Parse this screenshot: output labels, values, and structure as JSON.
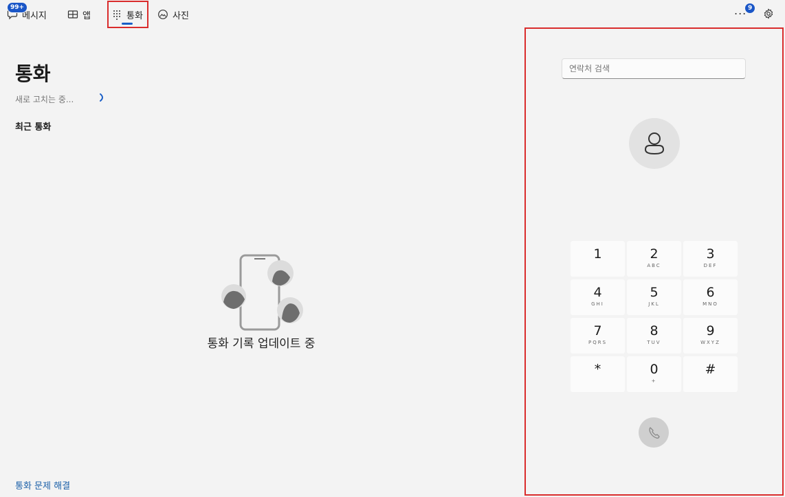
{
  "nav": {
    "tabs": [
      {
        "label": "메시지",
        "icon": "message-icon",
        "badge": "99+"
      },
      {
        "label": "앱",
        "icon": "apps-icon"
      },
      {
        "label": "통화",
        "icon": "dialpad-icon",
        "active": true
      },
      {
        "label": "사진",
        "icon": "photos-icon"
      }
    ],
    "more_label": "...",
    "more_badge": "9",
    "settings_icon": "gear-icon"
  },
  "main": {
    "title": "통화",
    "refresh_status": "새로 고치는 중...",
    "recent_header": "최근 통화",
    "empty_message": "통화 기록 업데이트 중",
    "troubleshoot_link": "통화 문제 해결"
  },
  "dialer": {
    "search_placeholder": "연락처 검색",
    "keys": [
      {
        "digit": "1",
        "letters": ""
      },
      {
        "digit": "2",
        "letters": "ABC"
      },
      {
        "digit": "3",
        "letters": "DEF"
      },
      {
        "digit": "4",
        "letters": "GHI"
      },
      {
        "digit": "5",
        "letters": "JKL"
      },
      {
        "digit": "6",
        "letters": "MNO"
      },
      {
        "digit": "7",
        "letters": "PQRS"
      },
      {
        "digit": "8",
        "letters": "TUV"
      },
      {
        "digit": "9",
        "letters": "WXYZ"
      },
      {
        "digit": "*",
        "letters": ""
      },
      {
        "digit": "0",
        "letters": "+"
      },
      {
        "digit": "#",
        "letters": ""
      }
    ]
  },
  "colors": {
    "accent": "#1a5fc7",
    "highlight_border": "#d92b2b",
    "link": "#1a5fa8"
  }
}
